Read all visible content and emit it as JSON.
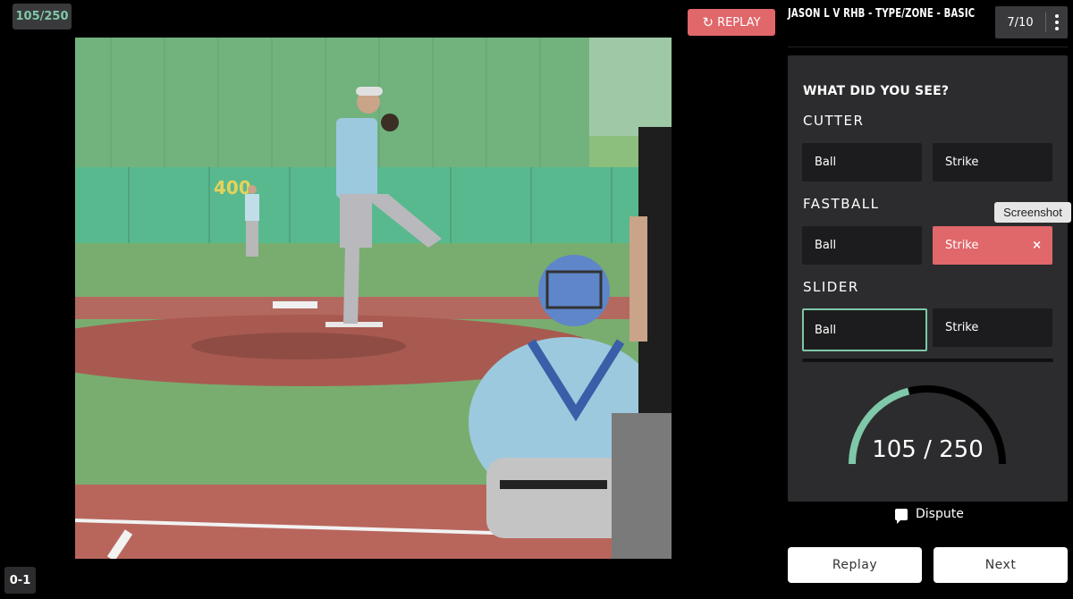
{
  "score_badge": "105/250",
  "count_badge": "0-1",
  "video": {
    "wall_sign": "400"
  },
  "replay_top": {
    "label": "REPLAY",
    "icon": "refresh-icon"
  },
  "header": {
    "title": "JASON L V RHB - TYPE/ZONE - BASIC",
    "progress": "7/10",
    "menu_icon": "kebab-menu-icon"
  },
  "question": "WHAT DID YOU SEE?",
  "pitches": [
    {
      "name": "CUTTER",
      "ball": "Ball",
      "strike": "Strike"
    },
    {
      "name": "FASTBALL",
      "ball": "Ball",
      "strike": "Strike",
      "strike_mark": "×"
    },
    {
      "name": "SLIDER",
      "ball": "Ball",
      "strike": "Strike"
    }
  ],
  "gauge": {
    "current": "105",
    "separator": "/",
    "total": "250",
    "value": 105,
    "max": 250
  },
  "tooltip": "Screenshot",
  "dispute": "Dispute",
  "buttons": {
    "replay": "Replay",
    "next": "Next"
  },
  "colors": {
    "accent": "#7fc8a9",
    "wrong": "#e0676a",
    "panel": "#2c2c2e",
    "choice": "#1c1c1e"
  }
}
